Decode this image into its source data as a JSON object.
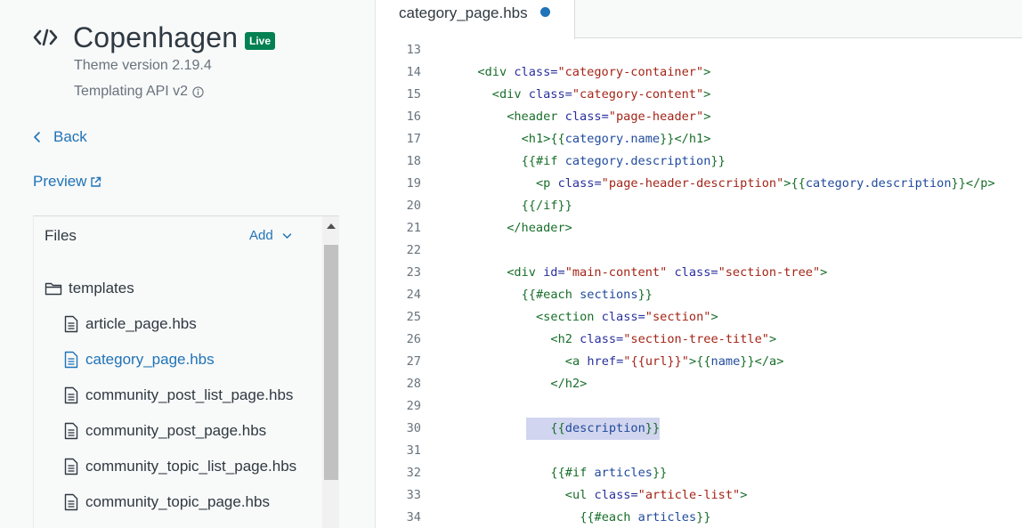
{
  "theme": {
    "name": "Copenhagen",
    "badge": "Live",
    "version": "Theme version 2.19.4",
    "api": "Templating API v2"
  },
  "nav": {
    "back": "Back",
    "preview": "Preview"
  },
  "files": {
    "header": "Files",
    "add": "Add",
    "folder": "templates",
    "items": [
      {
        "label": "article_page.hbs",
        "selected": false
      },
      {
        "label": "category_page.hbs",
        "selected": true
      },
      {
        "label": "community_post_list_page.hbs",
        "selected": false
      },
      {
        "label": "community_post_page.hbs",
        "selected": false
      },
      {
        "label": "community_topic_list_page.hbs",
        "selected": false
      },
      {
        "label": "community_topic_page.hbs",
        "selected": false
      }
    ]
  },
  "editor": {
    "tab": "category_page.hbs",
    "highlighted_line": 30,
    "lines": [
      {
        "n": "13",
        "indent": 0,
        "tokens": []
      },
      {
        "n": "14",
        "indent": 2,
        "tokens": [
          [
            "tag",
            "<div"
          ],
          [
            "text",
            " "
          ],
          [
            "attr",
            "class="
          ],
          [
            "str",
            "\"category-container\""
          ],
          [
            "tag",
            ">"
          ]
        ]
      },
      {
        "n": "15",
        "indent": 4,
        "tokens": [
          [
            "tag",
            "<div"
          ],
          [
            "text",
            " "
          ],
          [
            "attr",
            "class="
          ],
          [
            "str",
            "\"category-content\""
          ],
          [
            "tag",
            ">"
          ]
        ]
      },
      {
        "n": "16",
        "indent": 6,
        "tokens": [
          [
            "tag",
            "<header"
          ],
          [
            "text",
            " "
          ],
          [
            "attr",
            "class="
          ],
          [
            "str",
            "\"page-header\""
          ],
          [
            "tag",
            ">"
          ]
        ]
      },
      {
        "n": "17",
        "indent": 8,
        "tokens": [
          [
            "tag",
            "<h1>"
          ],
          [
            "hbs",
            "{{"
          ],
          [
            "hvar",
            "category.name"
          ],
          [
            "hbs",
            "}}"
          ],
          [
            "tag",
            "</h1>"
          ]
        ]
      },
      {
        "n": "18",
        "indent": 8,
        "tokens": [
          [
            "hbs",
            "{{#if"
          ],
          [
            "text",
            " "
          ],
          [
            "hvar",
            "category.description"
          ],
          [
            "hbs",
            "}}"
          ]
        ]
      },
      {
        "n": "19",
        "indent": 10,
        "tokens": [
          [
            "tag",
            "<p"
          ],
          [
            "text",
            " "
          ],
          [
            "attr",
            "class="
          ],
          [
            "str",
            "\"page-header-description\""
          ],
          [
            "tag",
            ">"
          ],
          [
            "hbs",
            "{{"
          ],
          [
            "hvar",
            "category.description"
          ],
          [
            "hbs",
            "}}"
          ],
          [
            "tag",
            "</p>"
          ]
        ]
      },
      {
        "n": "20",
        "indent": 8,
        "tokens": [
          [
            "hbs",
            "{{/if}}"
          ]
        ]
      },
      {
        "n": "21",
        "indent": 6,
        "tokens": [
          [
            "tag",
            "</header>"
          ]
        ]
      },
      {
        "n": "22",
        "indent": 0,
        "tokens": []
      },
      {
        "n": "23",
        "indent": 6,
        "tokens": [
          [
            "tag",
            "<div"
          ],
          [
            "text",
            " "
          ],
          [
            "attr",
            "id="
          ],
          [
            "str",
            "\"main-content\""
          ],
          [
            "text",
            " "
          ],
          [
            "attr",
            "class="
          ],
          [
            "str",
            "\"section-tree\""
          ],
          [
            "tag",
            ">"
          ]
        ]
      },
      {
        "n": "24",
        "indent": 8,
        "tokens": [
          [
            "hbs",
            "{{#each"
          ],
          [
            "text",
            " "
          ],
          [
            "hvar",
            "sections"
          ],
          [
            "hbs",
            "}}"
          ]
        ]
      },
      {
        "n": "25",
        "indent": 10,
        "tokens": [
          [
            "tag",
            "<section"
          ],
          [
            "text",
            " "
          ],
          [
            "attr",
            "class="
          ],
          [
            "str",
            "\"section\""
          ],
          [
            "tag",
            ">"
          ]
        ]
      },
      {
        "n": "26",
        "indent": 12,
        "tokens": [
          [
            "tag",
            "<h2"
          ],
          [
            "text",
            " "
          ],
          [
            "attr",
            "class="
          ],
          [
            "str",
            "\"section-tree-title\""
          ],
          [
            "tag",
            ">"
          ]
        ]
      },
      {
        "n": "27",
        "indent": 14,
        "tokens": [
          [
            "tag",
            "<a"
          ],
          [
            "text",
            " "
          ],
          [
            "attr",
            "href="
          ],
          [
            "str",
            "\"{{url}}\""
          ],
          [
            "tag",
            ">"
          ],
          [
            "hbs",
            "{{"
          ],
          [
            "hvar",
            "name"
          ],
          [
            "hbs",
            "}}"
          ],
          [
            "tag",
            "</a>"
          ]
        ]
      },
      {
        "n": "28",
        "indent": 12,
        "tokens": [
          [
            "tag",
            "</h2>"
          ]
        ]
      },
      {
        "n": "29",
        "indent": 0,
        "tokens": []
      },
      {
        "n": "30",
        "indent": 12,
        "tokens": [
          [
            "hbs",
            "{{"
          ],
          [
            "hvar",
            "description"
          ],
          [
            "hbs",
            "}}"
          ]
        ]
      },
      {
        "n": "31",
        "indent": 0,
        "tokens": []
      },
      {
        "n": "32",
        "indent": 12,
        "tokens": [
          [
            "hbs",
            "{{#if"
          ],
          [
            "text",
            " "
          ],
          [
            "hvar",
            "articles"
          ],
          [
            "hbs",
            "}}"
          ]
        ]
      },
      {
        "n": "33",
        "indent": 14,
        "tokens": [
          [
            "tag",
            "<ul"
          ],
          [
            "text",
            " "
          ],
          [
            "attr",
            "class="
          ],
          [
            "str",
            "\"article-list\""
          ],
          [
            "tag",
            ">"
          ]
        ]
      },
      {
        "n": "34",
        "indent": 16,
        "tokens": [
          [
            "hbs",
            "{{#each"
          ],
          [
            "text",
            " "
          ],
          [
            "hvar",
            "articles"
          ],
          [
            "hbs",
            "}}"
          ]
        ]
      }
    ]
  },
  "colors": {
    "accent": "#1f73b7",
    "live_badge": "#038153",
    "highlight": "#d2d5ef"
  }
}
